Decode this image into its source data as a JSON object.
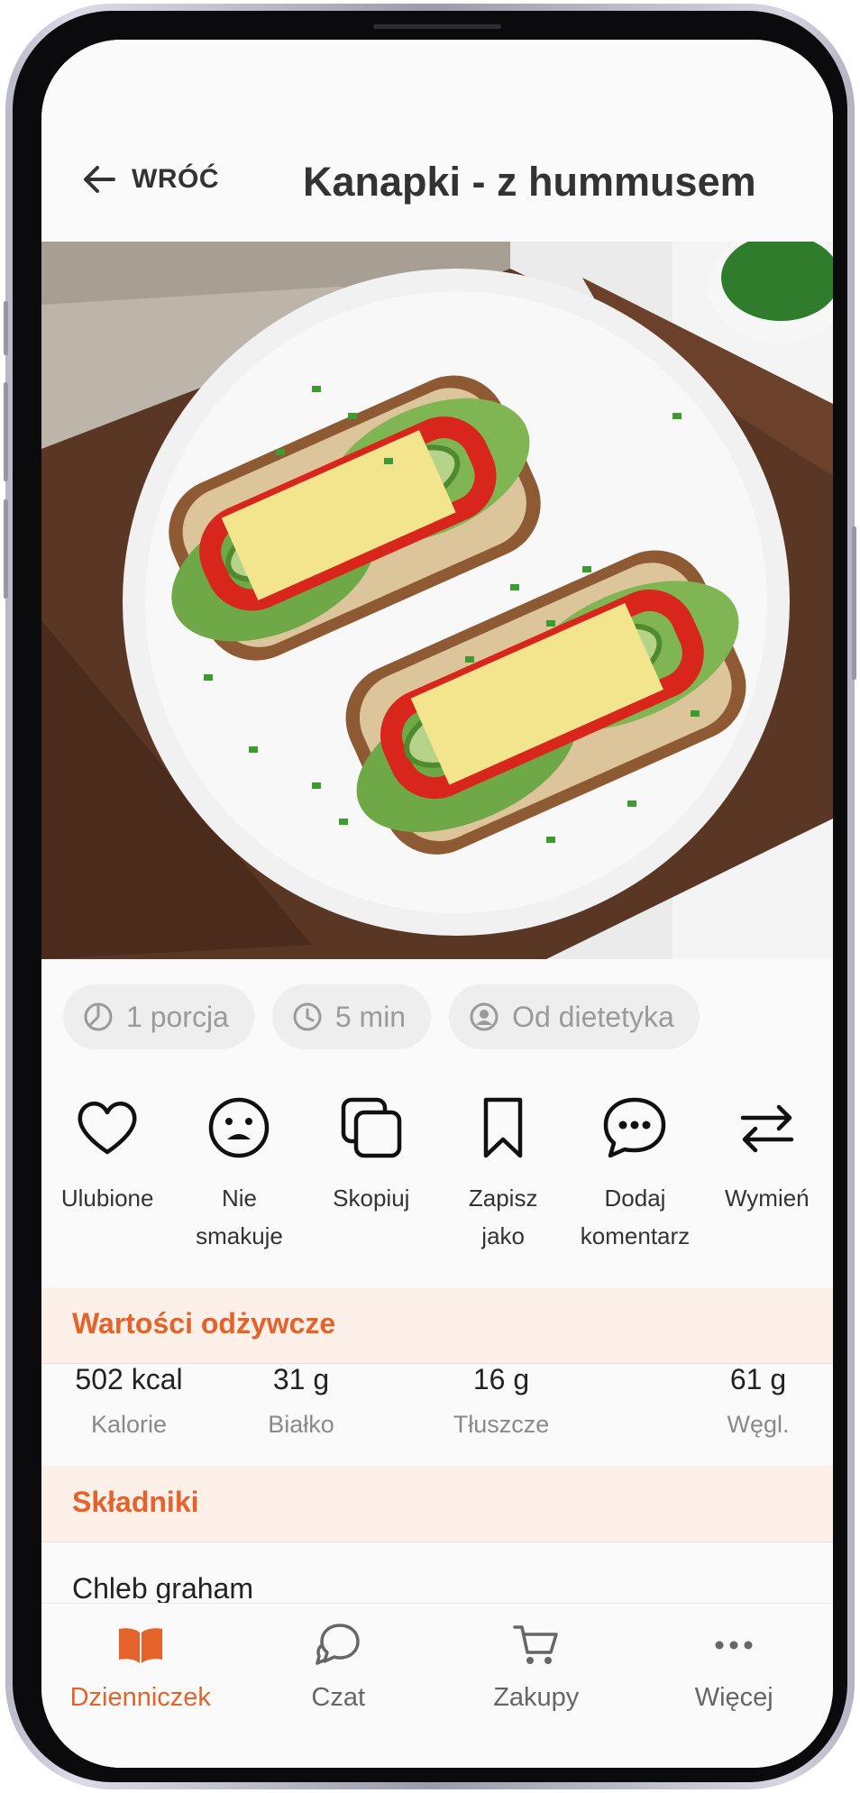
{
  "header": {
    "back_label": "WRÓĆ",
    "title": "Kanapki - z hummusem"
  },
  "photo": {
    "icon": "recipe-photo"
  },
  "chips": [
    {
      "icon": "pie-icon",
      "label": "1 porcja"
    },
    {
      "icon": "clock-icon",
      "label": "5 min"
    },
    {
      "icon": "person-icon",
      "label": "Od dietetyka"
    }
  ],
  "actions": [
    {
      "icon": "heart-icon",
      "label": "Ulubione"
    },
    {
      "icon": "sad-face-icon",
      "label": "Nie\nsmakuje"
    },
    {
      "icon": "copy-icon",
      "label": "Skopiuj"
    },
    {
      "icon": "bookmark-icon",
      "label": "Zapisz\njako"
    },
    {
      "icon": "comment-icon",
      "label": "Dodaj\nkomentarz"
    },
    {
      "icon": "swap-icon",
      "label": "Wymień"
    }
  ],
  "nutrition": {
    "heading": "Wartości odżywcze",
    "items": [
      {
        "value": "502 kcal",
        "label": "Kalorie"
      },
      {
        "value": "31 g",
        "label": "Białko"
      },
      {
        "value": "16 g",
        "label": "Tłuszcze"
      },
      {
        "value": "61 g",
        "label": "Węgl."
      }
    ]
  },
  "ingredients": {
    "heading": "Składniki",
    "items": [
      {
        "name": "Chleb graham"
      }
    ]
  },
  "nav": {
    "items": [
      {
        "icon": "book-icon",
        "label": "Dzienniczek",
        "active": true
      },
      {
        "icon": "chat-icon",
        "label": "Czat",
        "active": false
      },
      {
        "icon": "cart-icon",
        "label": "Zakupy",
        "active": false
      },
      {
        "icon": "more-icon",
        "label": "Więcej",
        "active": false
      }
    ]
  },
  "colors": {
    "accent": "#e5622b",
    "section_bg": "#fdf0e8",
    "chip_bg": "#eeeeee"
  }
}
